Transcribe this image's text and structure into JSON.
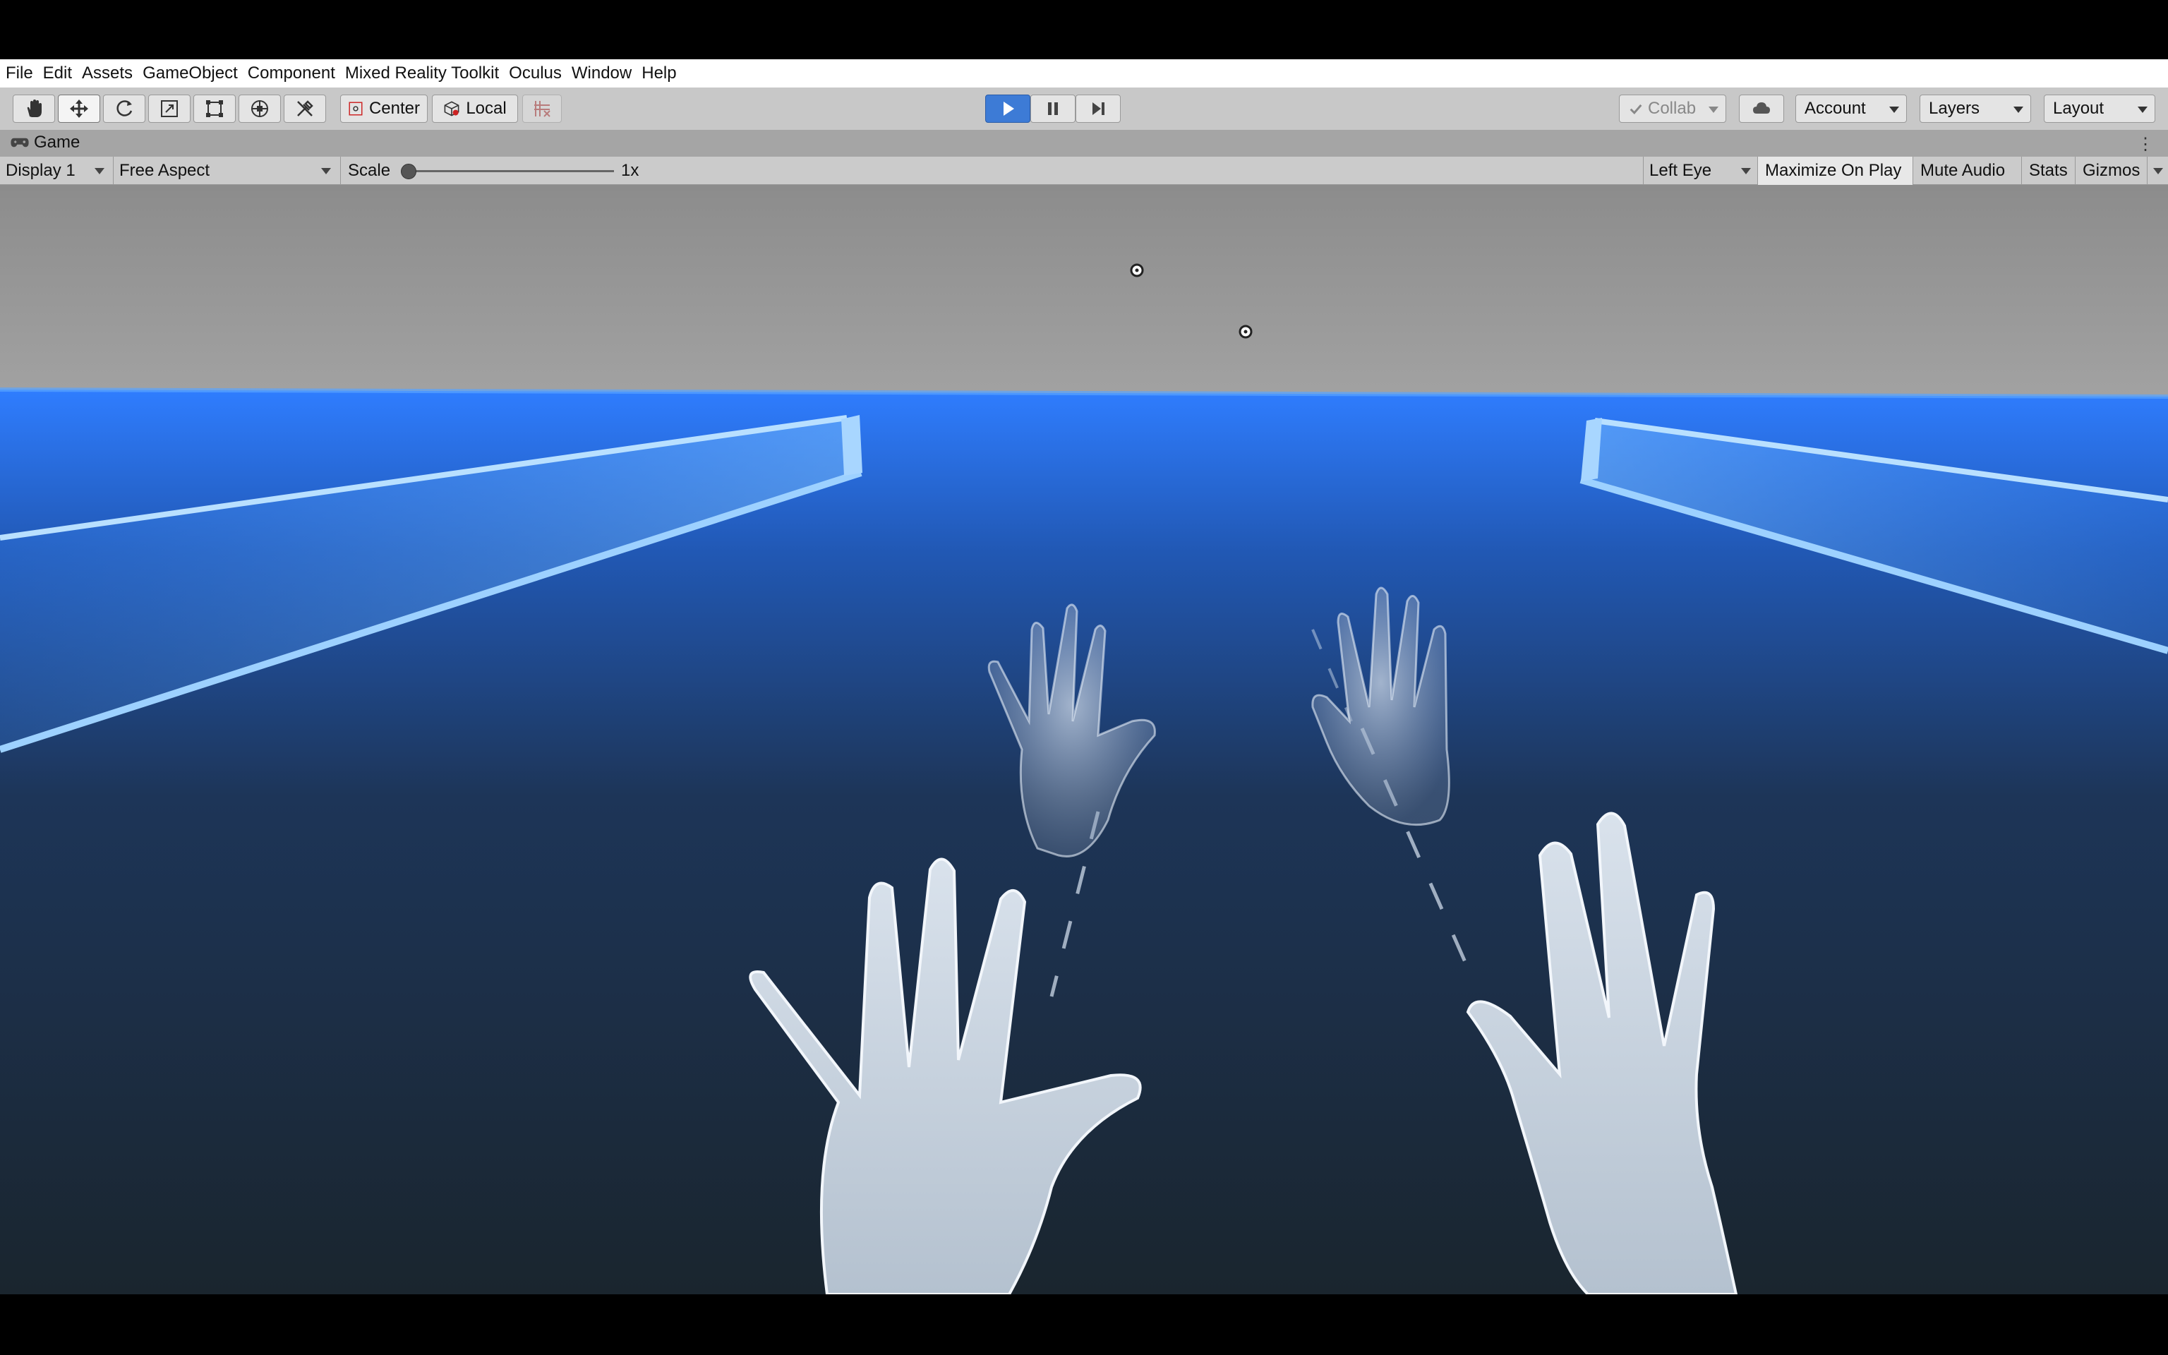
{
  "menu": [
    "File",
    "Edit",
    "Assets",
    "GameObject",
    "Component",
    "Mixed Reality Toolkit",
    "Oculus",
    "Window",
    "Help"
  ],
  "toolbar": {
    "tools": [
      {
        "name": "hand-tool-icon"
      },
      {
        "name": "move-tool-icon"
      },
      {
        "name": "rotate-tool-icon"
      },
      {
        "name": "scale-tool-icon"
      },
      {
        "name": "rect-tool-icon"
      },
      {
        "name": "transform-tool-icon"
      },
      {
        "name": "custom-tool-icon"
      }
    ],
    "pivot_label": "Center",
    "space_label": "Local",
    "collab_label": "Collab",
    "account_label": "Account",
    "layers_label": "Layers",
    "layout_label": "Layout",
    "play_state": "playing"
  },
  "tab": {
    "label": "Game"
  },
  "gamebar": {
    "display": "Display 1",
    "aspect": "Free Aspect",
    "scale_label": "Scale",
    "scale_value": "1x",
    "scale_level": 0.0,
    "eye": "Left Eye",
    "maximize": "Maximize On Play",
    "mute": "Mute Audio",
    "stats": "Stats",
    "gizmos": "Gizmos"
  },
  "colors": {
    "sky": "#8f8f8f",
    "horizon_blue": "#2f7dff",
    "floor_dark": "#1c2630",
    "hand_fill": "#c2ccd8",
    "panel_glow": "#6fb3ff",
    "play_blue": "#3d7bd6"
  }
}
